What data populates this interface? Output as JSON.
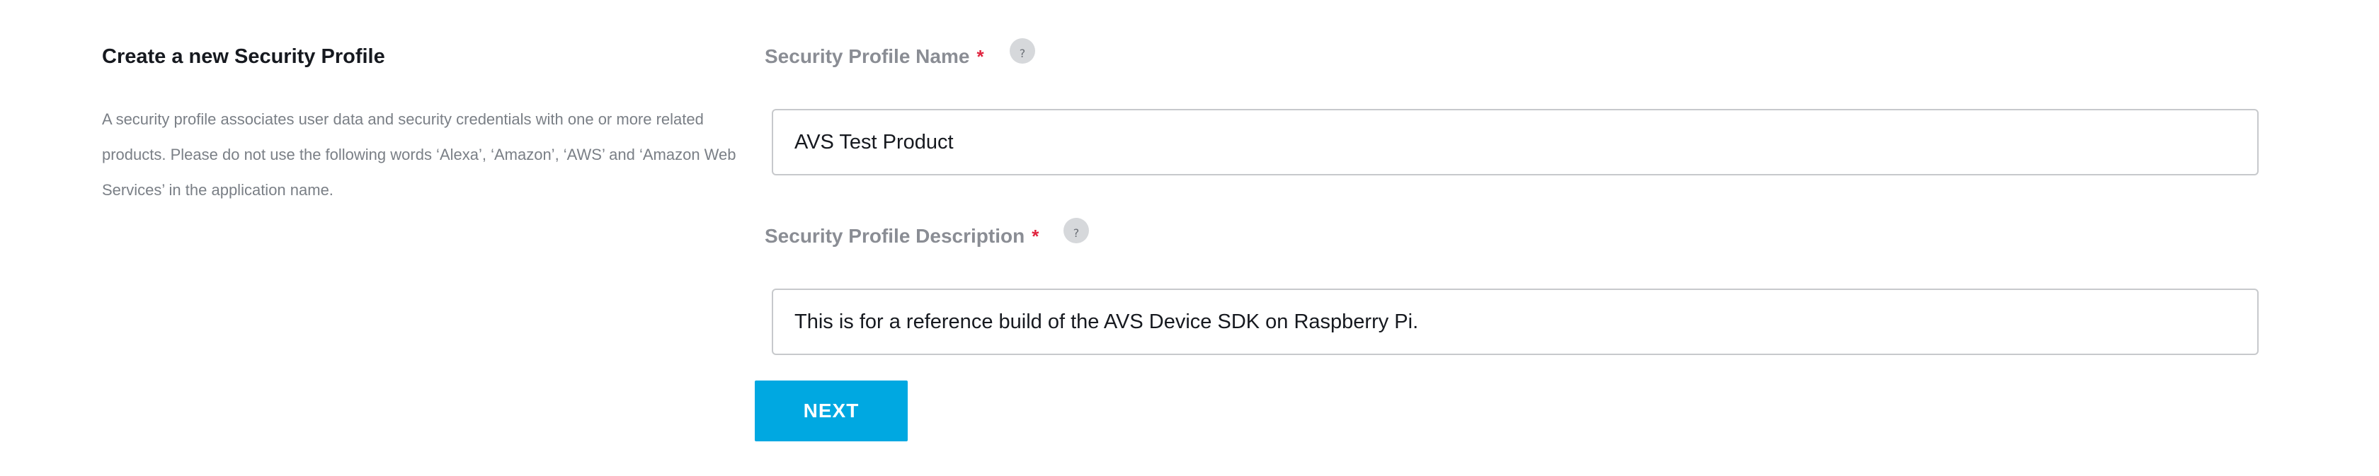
{
  "intro": {
    "title": "Create a new Security Profile",
    "description": "A security profile associates user data and security credentials with one or more related products. Please do not use the following words ‘Alexa’, ‘Amazon’, ‘AWS’ and ‘Amazon Web Services’ in the application name."
  },
  "form": {
    "name_field": {
      "label": "Security Profile Name",
      "required_marker": "*",
      "help_glyph": "?",
      "value": "AVS Test Product"
    },
    "description_field": {
      "label": "Security Profile Description",
      "required_marker": "*",
      "help_glyph": "?",
      "value": "This is for a reference build of the AVS Device SDK on Raspberry Pi."
    },
    "next_label": "NEXT"
  },
  "colors": {
    "accent": "#00a8e1",
    "required": "#e0243f",
    "label": "#8a8d94"
  },
  "icons": {
    "help": "question-mark-icon"
  }
}
